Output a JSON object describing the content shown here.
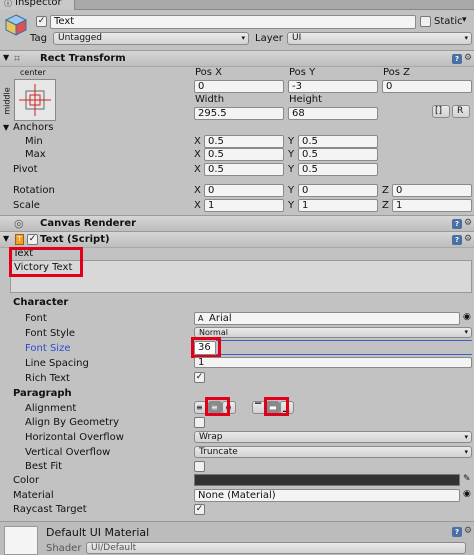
{
  "tab": {
    "title": "Inspector"
  },
  "object": {
    "name": "Text",
    "static_label": "Static",
    "tag_label": "Tag",
    "tag_value": "Untagged",
    "layer_label": "Layer",
    "layer_value": "UI"
  },
  "rect_transform": {
    "title": "Rect Transform",
    "anchor_h": "center",
    "anchor_v": "middle",
    "pos_x_label": "Pos X",
    "pos_y_label": "Pos Y",
    "pos_z_label": "Pos Z",
    "pos_x": "0",
    "pos_y": "-3",
    "pos_z": "0",
    "width_label": "Width",
    "height_label": "Height",
    "width": "295.5",
    "height": "68",
    "blueprint_btn": "[]",
    "raw_btn": "R",
    "anchors_label": "Anchors",
    "min_label": "Min",
    "max_label": "Max",
    "min_x": "0.5",
    "min_y": "0.5",
    "max_x": "0.5",
    "max_y": "0.5",
    "pivot_label": "Pivot",
    "pivot_x": "0.5",
    "pivot_y": "0.5",
    "rotation_label": "Rotation",
    "rot_x": "0",
    "rot_y": "0",
    "rot_z": "0",
    "scale_label": "Scale",
    "scale_x": "1",
    "scale_y": "1",
    "scale_z": "1",
    "x": "X",
    "y": "Y",
    "z": "Z"
  },
  "canvas_renderer": {
    "title": "Canvas Renderer"
  },
  "text_script": {
    "title": "Text (Script)",
    "text_label": "Text",
    "text_value": "Victory Text",
    "character_header": "Character",
    "font_label": "Font",
    "font_value": "Arial",
    "font_style_label": "Font Style",
    "font_style_value": "Normal",
    "font_size_label": "Font Size",
    "font_size_value": "36",
    "line_spacing_label": "Line Spacing",
    "line_spacing_value": "1",
    "rich_text_label": "Rich Text",
    "paragraph_header": "Paragraph",
    "alignment_label": "Alignment",
    "align_geometry_label": "Align By Geometry",
    "h_overflow_label": "Horizontal Overflow",
    "h_overflow_value": "Wrap",
    "v_overflow_label": "Vertical Overflow",
    "v_overflow_value": "Truncate",
    "best_fit_label": "Best Fit",
    "color_label": "Color",
    "material_label": "Material",
    "material_value": "None (Material)",
    "raycast_label": "Raycast Target"
  },
  "material_panel": {
    "name": "Default UI Material",
    "shader_label": "Shader",
    "shader_value": "UI/Default"
  },
  "colors": {
    "highlight": "#e0001a",
    "accent_blue": "#3a5fcd"
  },
  "icons": [
    "gameobject-cube-icon",
    "rect-transform-icon",
    "canvas-renderer-icon",
    "text-script-icon",
    "object-picker-icon",
    "help-icon",
    "gear-icon"
  ]
}
